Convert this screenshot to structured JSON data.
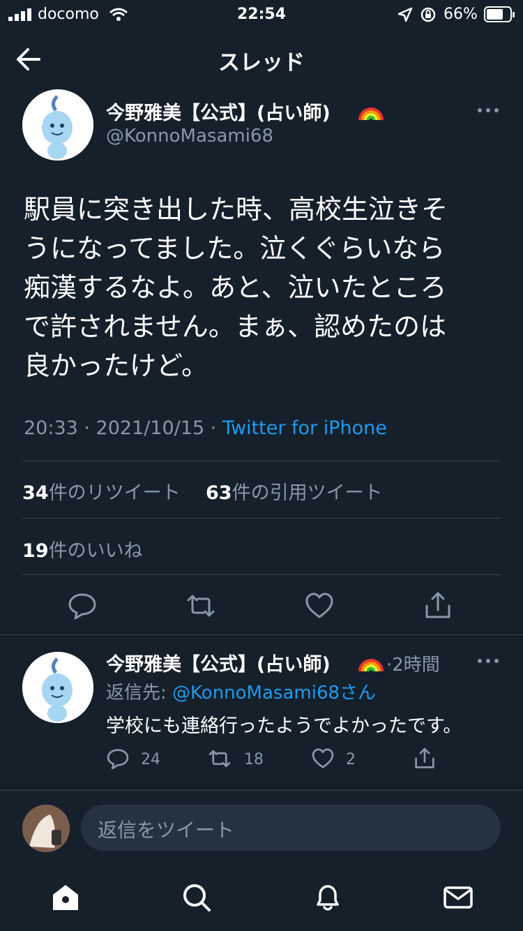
{
  "status_bar": {
    "carrier": "docomo",
    "time": "22:54",
    "battery": "66%"
  },
  "header": {
    "title": "スレッド"
  },
  "tweet": {
    "author_name": "今野雅美【公式】(占い師)",
    "handle": "@KonnoMasami68",
    "lines": [
      "駅員に突き出した時、高校生泣きそ",
      "うになってました。泣くぐらいなら",
      "痴漢するなよ。あと、泣いたところ",
      "で許されません。まぁ、認めたのは",
      "良かったけど。"
    ],
    "timestamp": "20:33 · 2021/10/15 · ",
    "source": "Twitter for iPhone",
    "retweet_count": "34",
    "retweet_label": "件のリツイート",
    "quote_count": "63",
    "quote_label": "件の引用ツイート",
    "like_count": "19",
    "like_label": "件のいいね"
  },
  "reply": {
    "author_name": "今野雅美【公式】(占い師)",
    "time": "·2時間",
    "reply_to_prefix": "返信先: ",
    "reply_to_handle": "@KonnoMasami68さん",
    "text": "学校にも連絡行ったようでよかったです。",
    "reply_count": "24",
    "retweet_count": "18",
    "like_count": "2"
  },
  "composer": {
    "placeholder": "返信をツイート"
  },
  "icons": {
    "accent": "#1d9bf0",
    "background": "#15202b",
    "muted": "#8899a6"
  }
}
